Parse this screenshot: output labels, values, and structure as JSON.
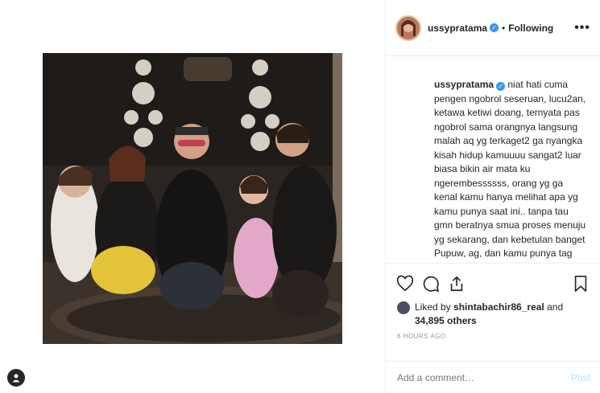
{
  "post": {
    "username": "ussypratama",
    "dot": "•",
    "following_label": "Following",
    "more_label": "•••",
    "caption_user": "ussypratama",
    "caption_text": " niat hati cuma pengen ngobrol seseruan, lucu2an, ketawa ketiwi doang, ternyata pas ngobrol sama orangnya langsung malah aq yg terkaget2 ga nyangka kisah hidup kamuuuu sangat2 luar biasa bikin air mata ku ngerembessssss, orang yg ga kenal kamu hanya melihat apa yg kamu punya saat ini.. tanpa tau gmn beratnya smua proses menuju yg sekarang, dan kebetulan banget Pupuw, ag, dan kamu punya tag line",
    "likes_prefix": "Liked by ",
    "likes_user": "shintabachir86_real",
    "likes_and": " and",
    "likes_count": "34,895 others",
    "time_label": "6 HOURS AGO",
    "comment_placeholder": "Add a comment…",
    "post_label": "Post"
  },
  "icons": {
    "verified": "verified-badge-icon",
    "like": "heart-icon",
    "comment": "comment-icon",
    "share": "share-icon",
    "save": "bookmark-icon",
    "profile": "user-profile-icon"
  },
  "colors": {
    "verified": "#3897f0",
    "post_disabled": "#b2dffc",
    "muted": "#999999"
  }
}
